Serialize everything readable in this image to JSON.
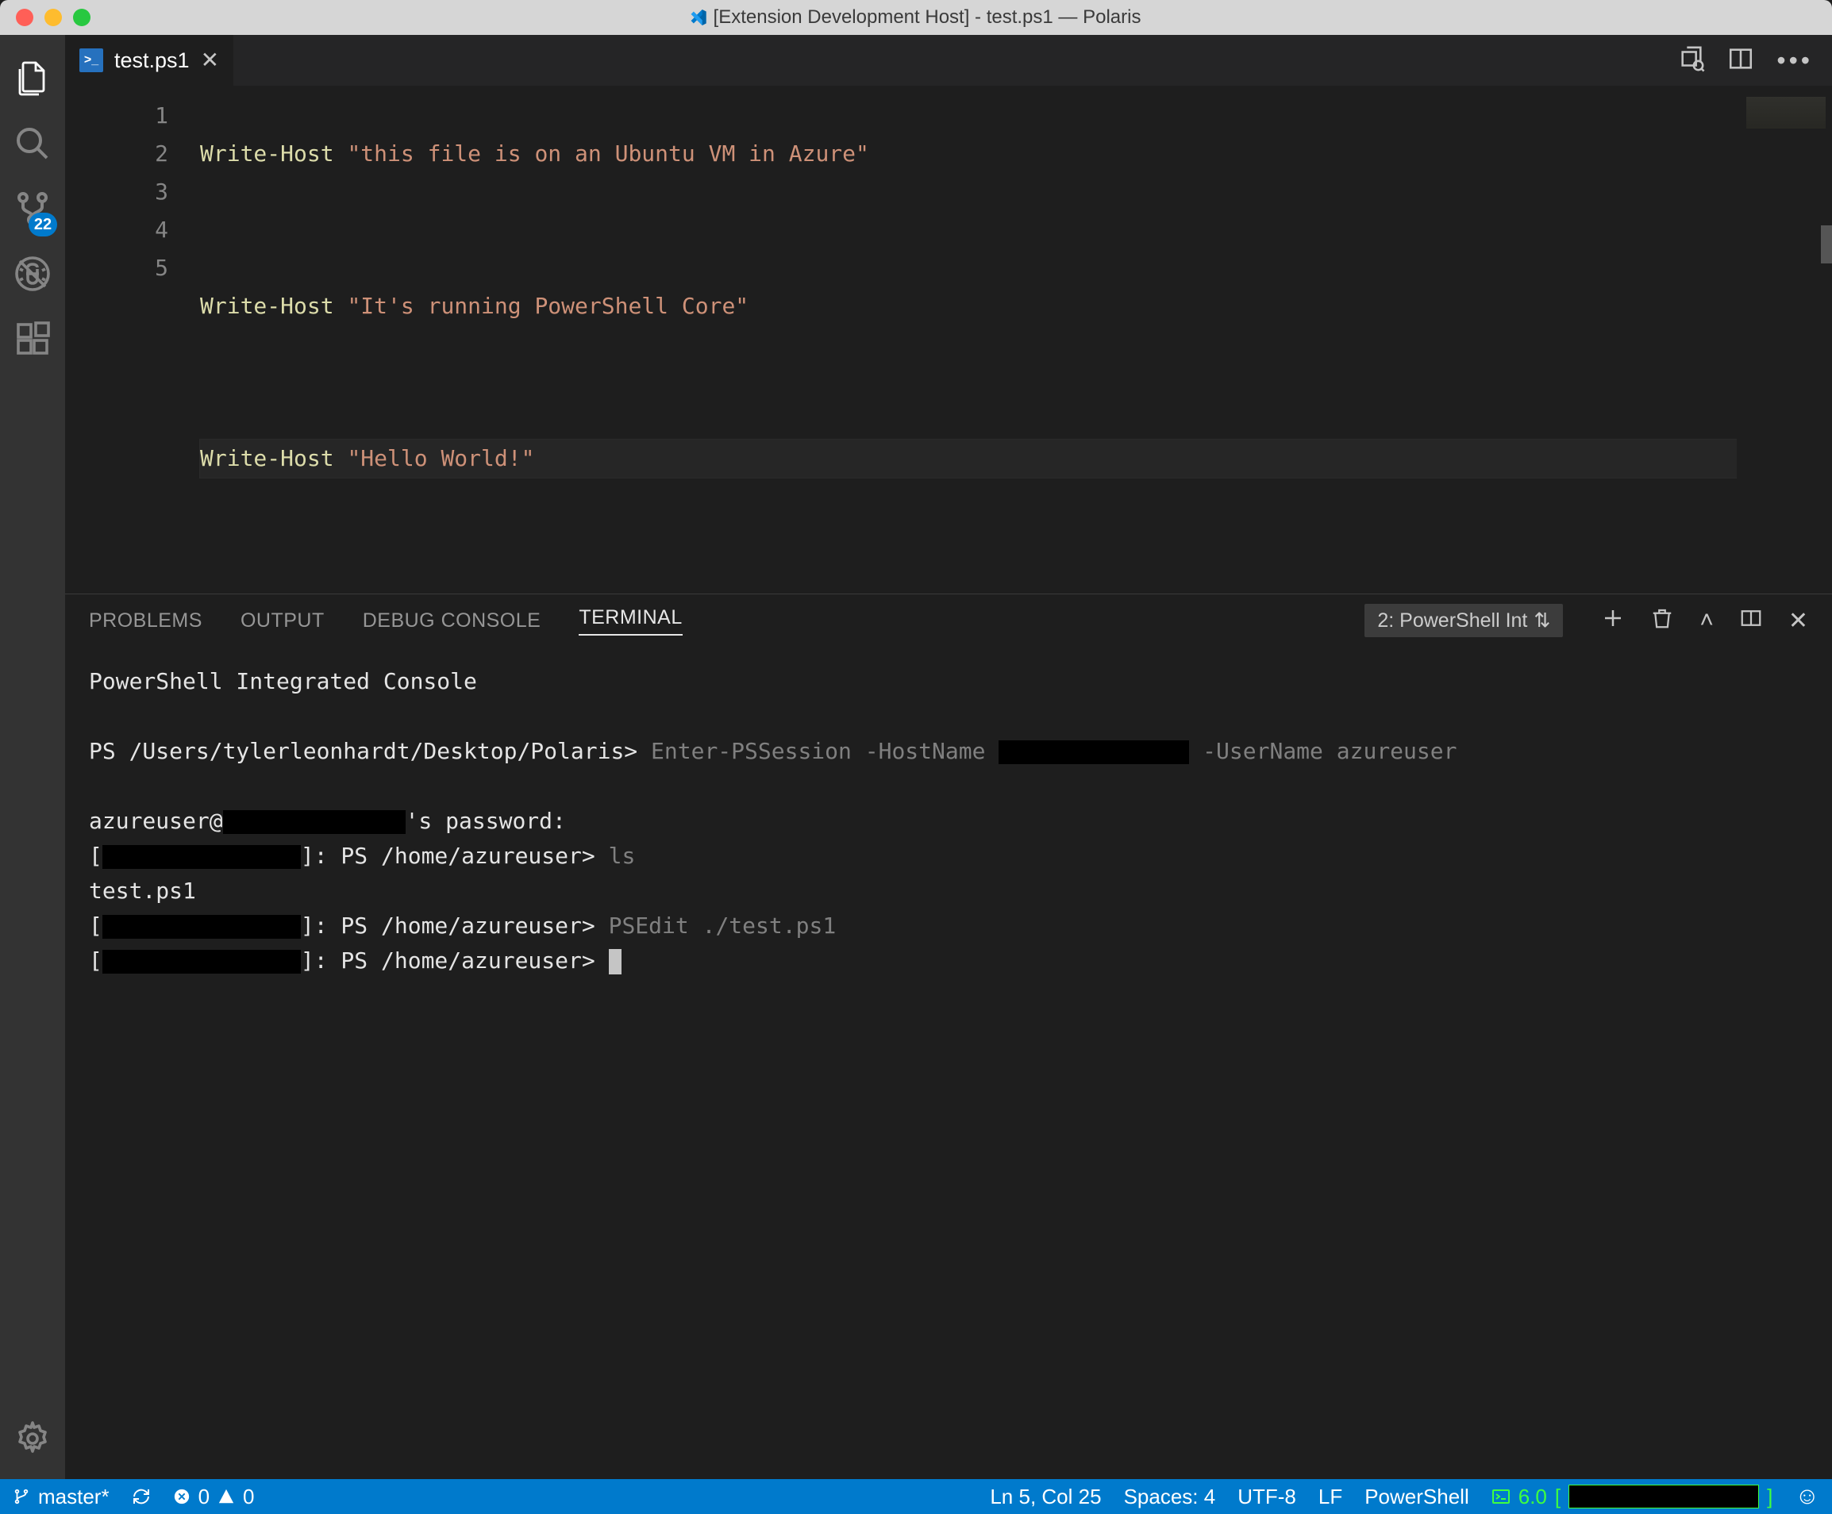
{
  "window": {
    "title": "[Extension Development Host] - test.ps1 — Polaris"
  },
  "activity": {
    "source_control_badge": "22"
  },
  "tab": {
    "filename": "test.ps1"
  },
  "code": {
    "line_numbers": [
      "1",
      "2",
      "3",
      "4",
      "5"
    ],
    "l1_cmd": "Write-Host",
    "l1_str": "\"this file is on an Ubuntu VM in Azure\"",
    "l3_cmd": "Write-Host",
    "l3_str": "\"It's running PowerShell Core\"",
    "l5_cmd": "Write-Host",
    "l5_str": "\"Hello World!\""
  },
  "panel": {
    "tabs": {
      "problems": "PROBLEMS",
      "output": "OUTPUT",
      "debug": "DEBUG CONSOLE",
      "terminal": "TERMINAL"
    },
    "terminal_selector": "2: PowerShell Int"
  },
  "terminal": {
    "banner": "PowerShell Integrated Console",
    "prompt1_pre": "PS /Users/tylerleonhardt/Desktop/Polaris>",
    "prompt1_cmd_a": "Enter-PSSession -HostName ",
    "prompt1_cmd_b": " -UserName azureuser",
    "pw_pre": "azureuser@",
    "pw_post": "'s password:",
    "l_open": "[",
    "l_close_ps": "]: PS /home/azureuser>",
    "cmd_ls": "ls",
    "ls_out": "test.ps1",
    "cmd_edit": "PSEdit ./test.ps1"
  },
  "status": {
    "branch": "master*",
    "errors": "0",
    "warnings": "0",
    "position": "Ln 5, Col 25",
    "spaces": "Spaces: 4",
    "encoding": "UTF-8",
    "eol": "LF",
    "language": "PowerShell",
    "ps_version": "6.0"
  }
}
